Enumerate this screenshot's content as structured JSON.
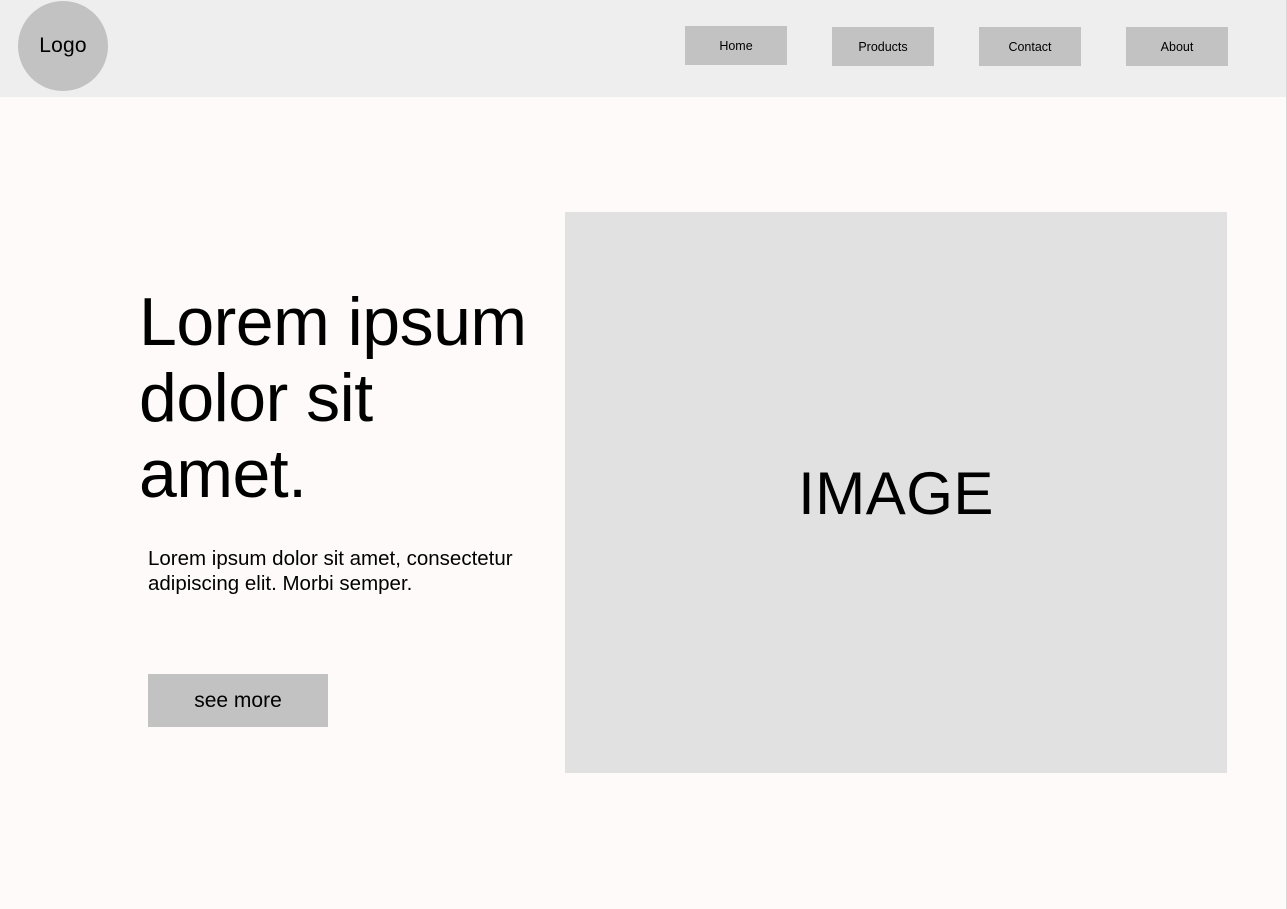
{
  "header": {
    "logo_text": "Logo",
    "nav": [
      {
        "label": "Home"
      },
      {
        "label": "Products"
      },
      {
        "label": "Contact"
      },
      {
        "label": "About"
      }
    ]
  },
  "hero": {
    "title": "Lorem ipsum dolor sit amet.",
    "subtitle": "Lorem ipsum dolor sit amet, consectetur adipiscing elit. Morbi semper.",
    "button_label": "see more",
    "image_label": "IMAGE"
  },
  "colors": {
    "header_bg": "#eeeeee",
    "page_bg": "#fffafa",
    "button_bg": "#c2c2c2",
    "image_bg": "#e1e1e1"
  }
}
